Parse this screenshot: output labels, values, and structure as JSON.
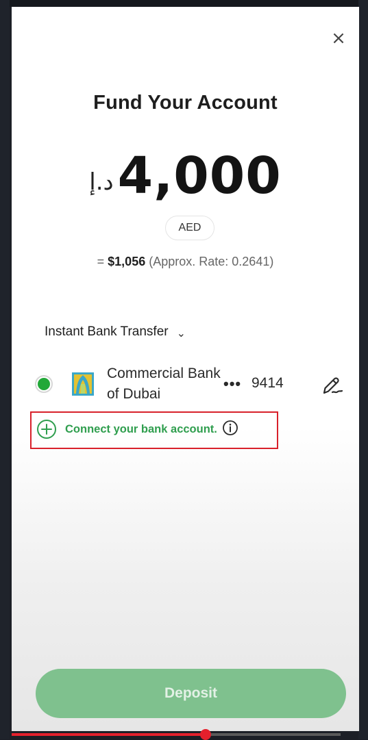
{
  "modal": {
    "title": "Fund Your Account",
    "close_label": "×"
  },
  "amount": {
    "currency_symbol": "د.إ",
    "value": "4,000",
    "currency_code": "AED"
  },
  "conversion": {
    "prefix": "= ",
    "usd_value": "$1,056",
    "rate_text": "(Approx. Rate: 0.2641)"
  },
  "payment_method": {
    "label": "Instant Bank Transfer",
    "chevron": "⌄"
  },
  "bank_account": {
    "selected": true,
    "bank_name": "Commercial Bank of Dubai",
    "mask": "•••",
    "last4": "9414",
    "logo_icon": "bank-logo-icon",
    "edit_icon": "pen-icon"
  },
  "connect": {
    "label": "Connect your bank account.",
    "plus_icon": "plus-circle-icon",
    "info_icon": "info-icon"
  },
  "deposit": {
    "label": "Deposit"
  },
  "video_progress": {
    "fraction": 0.59
  },
  "colors": {
    "accent_green": "#22a838",
    "connect_green": "#2f9e4e",
    "deposit_button": "#7fc18e",
    "highlight_red": "#d8202a",
    "progress_red": "#e5202c"
  }
}
